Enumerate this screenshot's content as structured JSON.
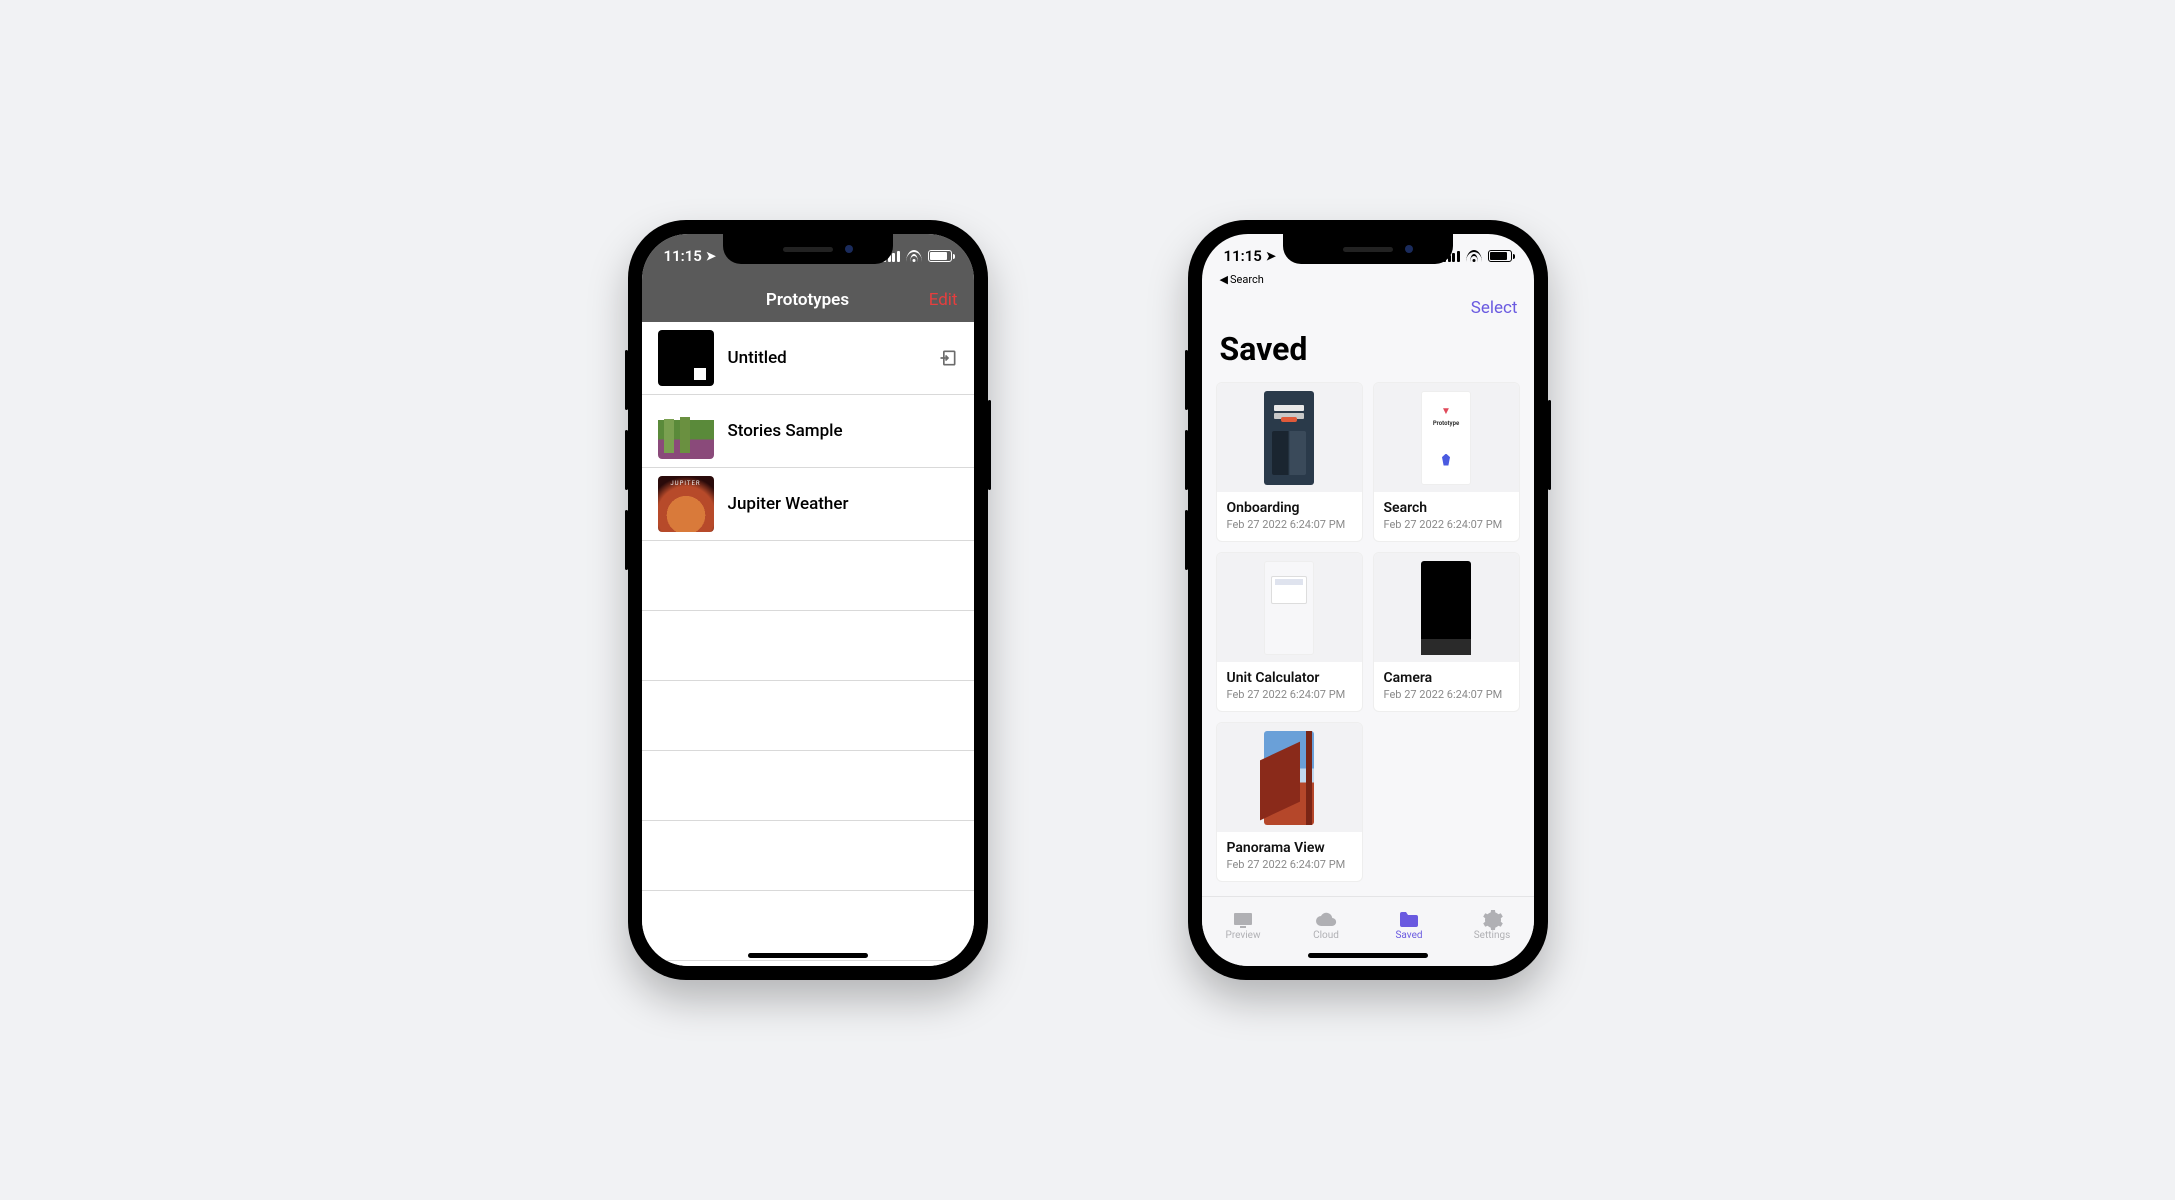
{
  "status_time": "11:15",
  "left": {
    "navbar": {
      "title": "Prototypes",
      "edit": "Edit"
    },
    "rows": [
      {
        "title": "Untitled",
        "thumb": "black",
        "has_import": true
      },
      {
        "title": "Stories Sample",
        "thumb": "stories",
        "has_import": false
      },
      {
        "title": "Jupiter Weather",
        "thumb": "jupiter",
        "has_import": false
      }
    ]
  },
  "right": {
    "back_label": "Search",
    "navbar": {
      "select": "Select"
    },
    "title": "Saved",
    "cards": [
      {
        "name": "Onboarding",
        "date": "Feb 27 2022 6:24:07 PM",
        "variant": "onboarding"
      },
      {
        "name": "Search",
        "date": "Feb 27 2022 6:24:07 PM",
        "variant": "search"
      },
      {
        "name": "Unit Calculator",
        "date": "Feb 27 2022 6:24:07 PM",
        "variant": "unit"
      },
      {
        "name": "Camera",
        "date": "Feb 27 2022 6:24:07 PM",
        "variant": "camera"
      },
      {
        "name": "Panorama View",
        "date": "Feb 27 2022 6:24:07 PM",
        "variant": "panorama"
      }
    ],
    "tabs": [
      {
        "label": "Preview",
        "icon": "preview-icon",
        "active": false
      },
      {
        "label": "Cloud",
        "icon": "cloud-icon",
        "active": false
      },
      {
        "label": "Saved",
        "icon": "folder-icon",
        "active": true
      },
      {
        "label": "Settings",
        "icon": "gear-icon",
        "active": false
      }
    ]
  }
}
